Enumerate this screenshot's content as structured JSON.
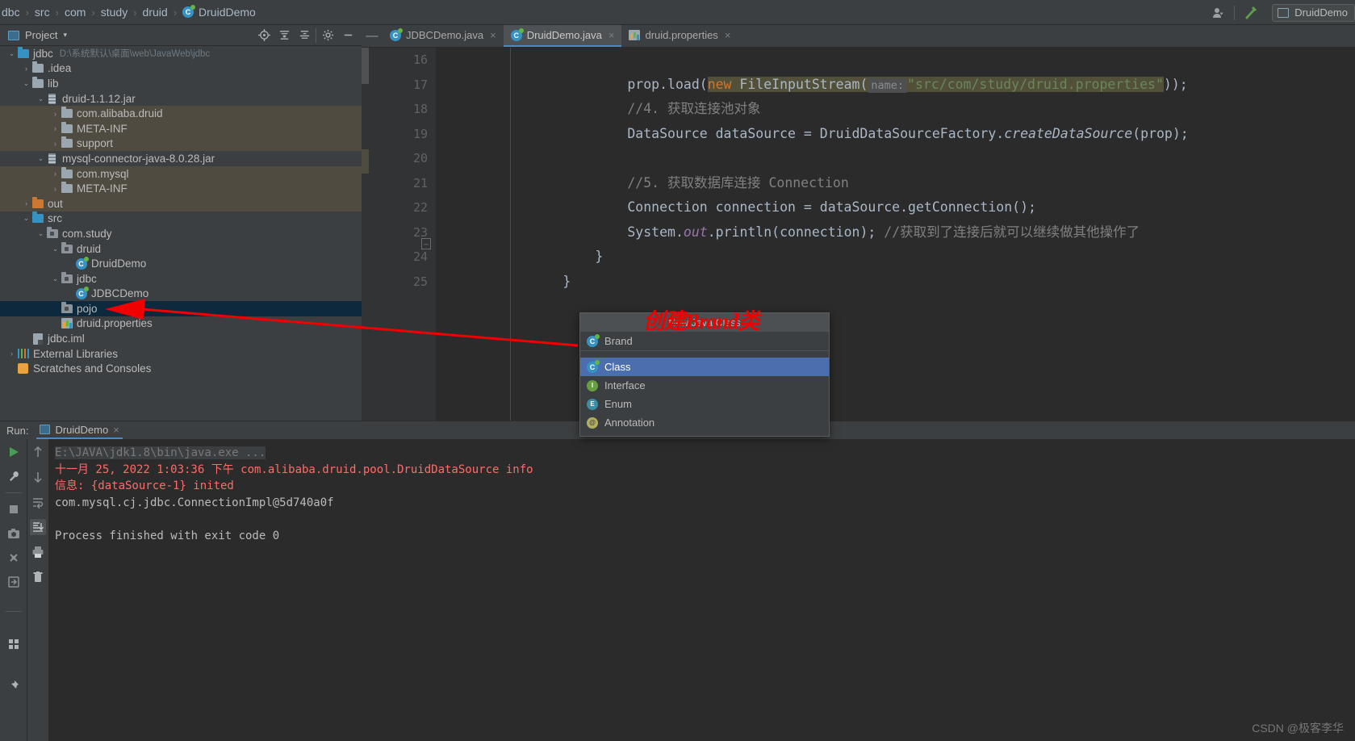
{
  "breadcrumb": {
    "items": [
      "dbc",
      "src",
      "com",
      "study",
      "druid"
    ],
    "file": "DruidDemo",
    "separator": "›"
  },
  "topright": {
    "people_icon": "people-icon",
    "hammer_icon": "build-hammer-icon",
    "run_config": "DruidDemo"
  },
  "project_panel": {
    "title": "Project",
    "dropdown_caret": "▾",
    "icons": [
      "locate-icon",
      "expand-all-icon",
      "collapse-all-icon",
      "gear-icon"
    ],
    "collapse_icon": "minimize-icon",
    "tree": [
      {
        "label": "jdbc",
        "path": "D:\\系统默认\\桌面\\web\\JavaWeb\\jdbc",
        "indent": 0,
        "arrow": "⌄",
        "icon": "module-folder-icon",
        "state": "normal"
      },
      {
        "label": ".idea",
        "path": "",
        "indent": 1,
        "arrow": "›",
        "icon": "folder-icon",
        "state": "normal"
      },
      {
        "label": "lib",
        "path": "",
        "indent": 1,
        "arrow": "⌄",
        "icon": "folder-icon",
        "state": "normal"
      },
      {
        "label": "druid-1.1.12.jar",
        "path": "",
        "indent": 2,
        "arrow": "⌄",
        "icon": "jar-icon",
        "state": "normal"
      },
      {
        "label": "com.alibaba.druid",
        "path": "",
        "indent": 3,
        "arrow": "›",
        "icon": "folder-icon",
        "state": "library"
      },
      {
        "label": "META-INF",
        "path": "",
        "indent": 3,
        "arrow": "›",
        "icon": "folder-icon",
        "state": "library"
      },
      {
        "label": "support",
        "path": "",
        "indent": 3,
        "arrow": "›",
        "icon": "folder-icon",
        "state": "library"
      },
      {
        "label": "mysql-connector-java-8.0.28.jar",
        "path": "",
        "indent": 2,
        "arrow": "⌄",
        "icon": "jar-icon",
        "state": "normal"
      },
      {
        "label": "com.mysql",
        "path": "",
        "indent": 3,
        "arrow": "›",
        "icon": "folder-icon",
        "state": "library"
      },
      {
        "label": "META-INF",
        "path": "",
        "indent": 3,
        "arrow": "›",
        "icon": "folder-icon",
        "state": "library"
      },
      {
        "label": "out",
        "path": "",
        "indent": 1,
        "arrow": "›",
        "icon": "out-folder-icon",
        "state": "library"
      },
      {
        "label": "src",
        "path": "",
        "indent": 1,
        "arrow": "⌄",
        "icon": "source-folder-icon",
        "state": "normal"
      },
      {
        "label": "com.study",
        "path": "",
        "indent": 2,
        "arrow": "⌄",
        "icon": "package-icon",
        "state": "normal"
      },
      {
        "label": "druid",
        "path": "",
        "indent": 3,
        "arrow": "⌄",
        "icon": "package-icon",
        "state": "normal"
      },
      {
        "label": "DruidDemo",
        "path": "",
        "indent": 4,
        "arrow": "",
        "icon": "java-class-icon",
        "state": "normal"
      },
      {
        "label": "jdbc",
        "path": "",
        "indent": 3,
        "arrow": "⌄",
        "icon": "package-icon",
        "state": "normal"
      },
      {
        "label": "JDBCDemo",
        "path": "",
        "indent": 4,
        "arrow": "",
        "icon": "java-class-icon",
        "state": "normal"
      },
      {
        "label": "pojo",
        "path": "",
        "indent": 3,
        "arrow": "",
        "icon": "package-icon",
        "state": "selected"
      },
      {
        "label": "druid.properties",
        "path": "",
        "indent": 3,
        "arrow": "",
        "icon": "properties-icon",
        "state": "normal"
      },
      {
        "label": "jdbc.iml",
        "path": "",
        "indent": 1,
        "arrow": "",
        "icon": "iml-icon",
        "state": "normal"
      },
      {
        "label": "External Libraries",
        "path": "",
        "indent": 0,
        "arrow": "›",
        "icon": "libraries-icon",
        "state": "normal"
      },
      {
        "label": "Scratches and Consoles",
        "path": "",
        "indent": 0,
        "arrow": "",
        "icon": "scratches-icon",
        "state": "normal"
      }
    ]
  },
  "editor": {
    "tabs": [
      {
        "label": "JDBCDemo.java",
        "icon": "java-class-icon",
        "active": false,
        "close": "×"
      },
      {
        "label": "DruidDemo.java",
        "icon": "java-class-icon",
        "active": true,
        "close": "×"
      },
      {
        "label": "druid.properties",
        "icon": "properties-icon",
        "active": false,
        "close": "×"
      }
    ],
    "line_numbers": [
      "16",
      "17",
      "18",
      "19",
      "20",
      "21",
      "22",
      "23",
      "24",
      "25"
    ],
    "code": {
      "l16_a": "prop.load(",
      "l16_new": "new",
      "l16_b": " FileInputStream(",
      "l16_hint": "name:",
      "l16_str": "\"src/com/study/druid.properties\"",
      "l16_end": "));",
      "l17": "//4. 获取连接池对象",
      "l18_a": "DataSource dataSource = DruidDataSourceFactory.",
      "l18_mth": "createDataSource",
      "l18_b": "(prop);",
      "l20": "//5. 获取数据库连接 Connection",
      "l21": "Connection connection = dataSource.getConnection();",
      "l22_a": "System.",
      "l22_out": "out",
      "l22_b": ".println(connection);",
      "l22_cmt": "//获取到了连接后就可以继续做其他操作了",
      "l23": "}",
      "l24": "}"
    }
  },
  "popup": {
    "header": "New Java Class",
    "items": [
      {
        "label": "Brand",
        "icon": "java-class-icon",
        "selected": false,
        "group": "suggestion"
      },
      {
        "label": "Class",
        "icon": "java-class-icon",
        "selected": true,
        "group": "kind"
      },
      {
        "label": "Interface",
        "icon": "java-interface-icon",
        "selected": false,
        "group": "kind"
      },
      {
        "label": "Enum",
        "icon": "java-enum-icon",
        "selected": false,
        "group": "kind"
      },
      {
        "label": "Annotation",
        "icon": "java-annotation-icon",
        "selected": false,
        "group": "kind"
      }
    ]
  },
  "annotation": {
    "text": "创建Brand类",
    "color": "#f00000",
    "arrow": "red-arrow-pointer"
  },
  "run_panel": {
    "label": "Run:",
    "tab": "DruidDemo",
    "tab_close": "×",
    "left_tools": [
      "rerun-icon",
      "wrench-icon",
      "stop-icon",
      "camera-icon",
      "thread-dump-icon",
      "exit-icon"
    ],
    "right_tools": [
      "up-arrow-icon",
      "down-arrow-icon",
      "soft-wrap-icon",
      "scroll-to-end-icon",
      "print-icon",
      "trash-icon"
    ],
    "console": [
      {
        "text": "E:\\JAVA\\jdk1.8\\bin\\java.exe ...",
        "style": "dim"
      },
      {
        "text": "十一月 25, 2022 1:03:36 下午 com.alibaba.druid.pool.DruidDataSource info",
        "style": "error"
      },
      {
        "text": "信息: {dataSource-1} inited",
        "style": "error"
      },
      {
        "text": "com.mysql.cj.jdbc.ConnectionImpl@5d740a0f",
        "style": "normal"
      },
      {
        "text": "",
        "style": "normal"
      },
      {
        "text": "Process finished with exit code 0",
        "style": "normal"
      }
    ]
  },
  "watermark": "CSDN @极客李华"
}
